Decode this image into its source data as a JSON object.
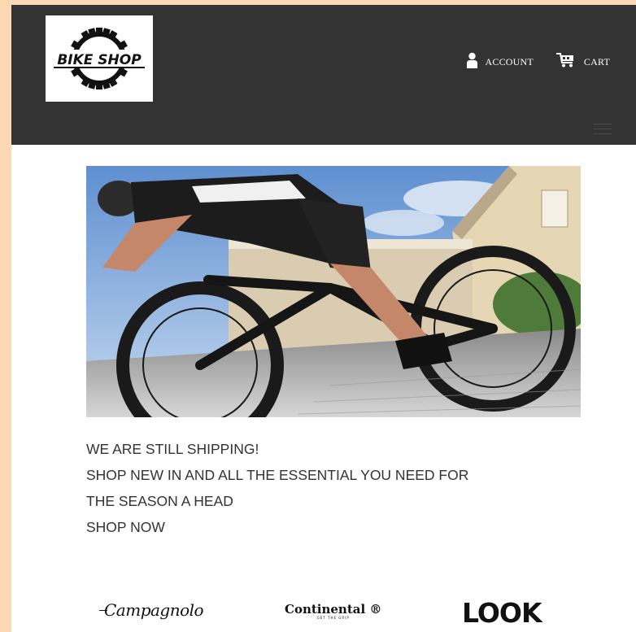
{
  "header": {
    "logo_text": "BIKE SHOP",
    "nav": {
      "account_label": "ACCOUNT",
      "cart_label": "CART"
    }
  },
  "promo": {
    "line1": "WE ARE STILL SHIPPING!",
    "line2": "SHOP NEW IN AND ALL THE ESSENTIAL YOU NEED FOR",
    "line3": "THE SEASON A HEAD",
    "cta": "SHOP NOW"
  },
  "brands": {
    "campagnolo": "Campagnolo",
    "continental": "Continental",
    "continental_sub": "GET THE GRIP",
    "look": "LOOK"
  },
  "colors": {
    "header_bg": "#333333",
    "page_bg": "#fcd7b4",
    "text": "#333333"
  },
  "icons": {
    "account": "user-icon",
    "cart": "cart-icon",
    "menu": "hamburger-icon"
  }
}
